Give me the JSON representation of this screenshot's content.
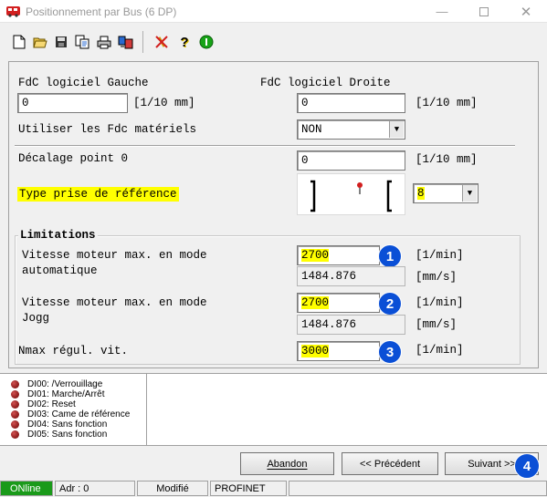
{
  "window": {
    "title": "Positionnement par Bus (6 DP)"
  },
  "toolbar": {
    "buttons": [
      "new-icon",
      "open-icon",
      "save-icon",
      "copy-icon",
      "print-icon",
      "transfer-icon",
      "disconnect-icon",
      "help-icon",
      "info-icon"
    ]
  },
  "soft_limits": {
    "left_label": "FdC logiciel Gauche",
    "left_value": "0",
    "left_unit": "[1/10 mm]",
    "right_label": "FdC logiciel Droite",
    "right_value": "0",
    "right_unit": "[1/10 mm]",
    "hw_label": "Utiliser les Fdc matériels",
    "hw_value": "NON"
  },
  "reference": {
    "offset_label": "Décalage point 0",
    "offset_value": "0",
    "offset_unit": "[1/10 mm]",
    "type_label": "Type prise de référence",
    "type_value": "8"
  },
  "limitations": {
    "title": "Limitations",
    "auto_label_1": "Vitesse moteur max. en mode",
    "auto_label_2": "automatique",
    "auto_value": "2700",
    "auto_unit": "[1/min]",
    "auto_mms": "1484.876",
    "auto_mms_unit": "[mm/s]",
    "jog_label_1": "Vitesse moteur max. en mode",
    "jog_label_2": "Jogg",
    "jog_value": "2700",
    "jog_unit": "[1/min]",
    "jog_mms": "1484.876",
    "jog_mms_unit": "[mm/s]",
    "nmax_label": "Nmax régul. vit.",
    "nmax_value": "3000",
    "nmax_unit": "[1/min]",
    "badges": [
      "1",
      "2",
      "3",
      "4"
    ]
  },
  "log": [
    "DI00: /Verrouillage",
    "DI01: Marche/Arrêt",
    "DI02: Reset",
    "DI03: Came de référence",
    "DI04: Sans fonction",
    "DI05: Sans fonction"
  ],
  "buttons": {
    "abort": "Abandon",
    "prev": "<< Précédent",
    "next": "Suivant >>"
  },
  "status": {
    "online": "ONline",
    "addr": "Adr : 0",
    "modified": "Modifié",
    "bus": "PROFINET"
  },
  "colors": {
    "accent": "#0a4fd6",
    "highlight": "#ffff00",
    "online": "#1a9a1a"
  }
}
